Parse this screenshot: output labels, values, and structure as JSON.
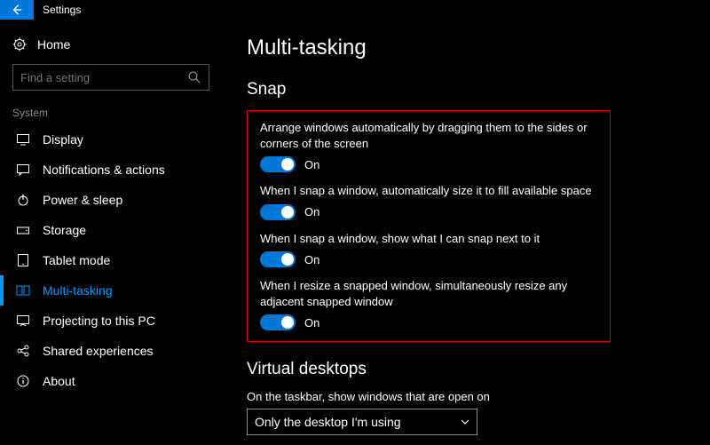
{
  "title": "Settings",
  "sidebar": {
    "home": "Home",
    "search_placeholder": "Find a setting",
    "group": "System",
    "items": [
      {
        "label": "Display"
      },
      {
        "label": "Notifications & actions"
      },
      {
        "label": "Power & sleep"
      },
      {
        "label": "Storage"
      },
      {
        "label": "Tablet mode"
      },
      {
        "label": "Multi-tasking"
      },
      {
        "label": "Projecting to this PC"
      },
      {
        "label": "Shared experiences"
      },
      {
        "label": "About"
      }
    ]
  },
  "main": {
    "title": "Multi-tasking",
    "snap_heading": "Snap",
    "snap": [
      {
        "desc": "Arrange windows automatically by dragging them to the sides or corners of the screen",
        "state": "On"
      },
      {
        "desc": "When I snap a window, automatically size it to fill available space",
        "state": "On"
      },
      {
        "desc": "When I snap a window, show what I can snap next to it",
        "state": "On"
      },
      {
        "desc": "When I resize a snapped window, simultaneously resize any adjacent snapped window",
        "state": "On"
      }
    ],
    "vd_heading": "Virtual desktops",
    "vd_desc": "On the taskbar, show windows that are open on",
    "vd_selected": "Only the desktop I'm using"
  }
}
